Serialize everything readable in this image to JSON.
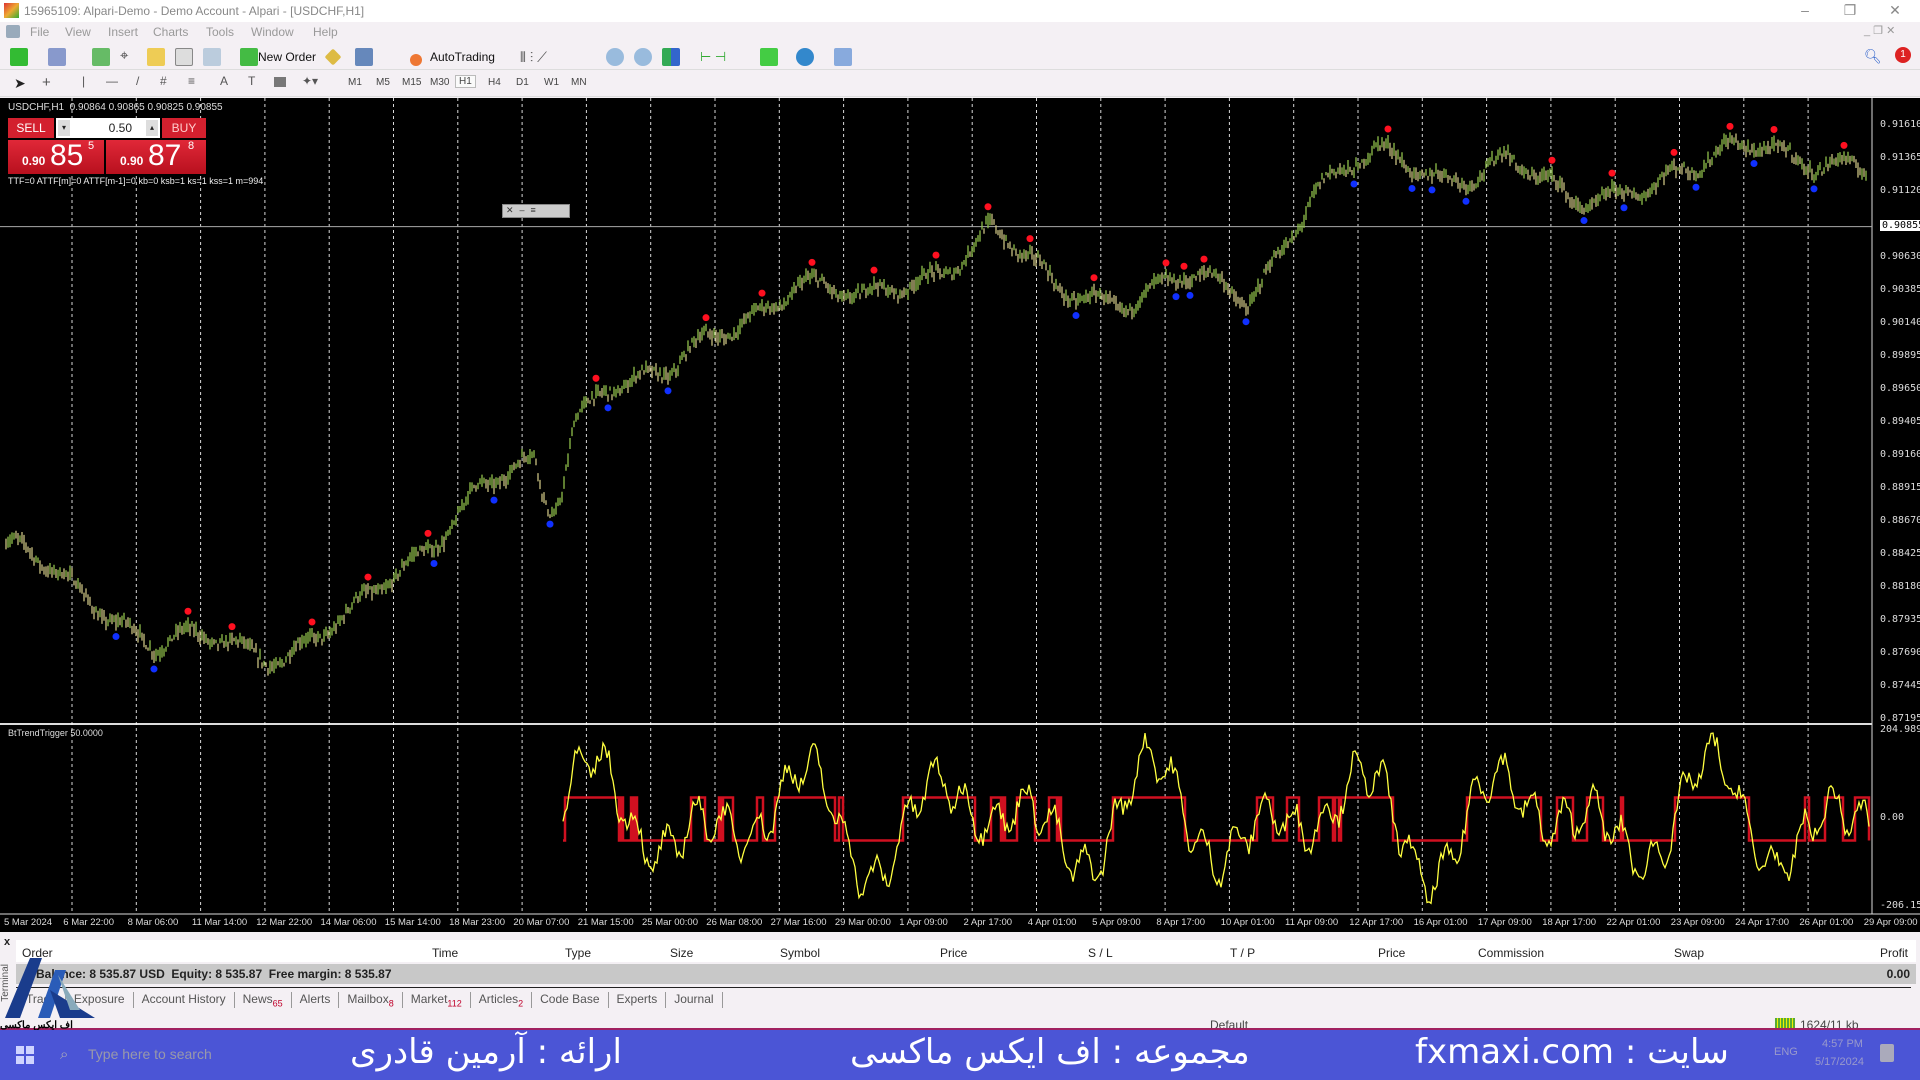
{
  "window": {
    "title": "15965109: Alpari-Demo - Demo Account - Alpari - [USDCHF,H1]"
  },
  "menu": [
    "File",
    "View",
    "Insert",
    "Charts",
    "Tools",
    "Window",
    "Help"
  ],
  "toolbar": {
    "new_order": "New Order",
    "autotrading": "AutoTrading",
    "notification_count": "1"
  },
  "timeframes": [
    "M1",
    "M5",
    "M15",
    "M30",
    "H1",
    "H4",
    "D1",
    "W1",
    "MN"
  ],
  "active_timeframe": "H1",
  "chart": {
    "header": "USDCHF,H1  0.90864 0.90865 0.90825 0.90855",
    "sell_label": "SELL",
    "buy_label": "BUY",
    "lot": "0.50",
    "sell_prefix": "0.90",
    "sell_big": "85",
    "sell_sup": "5",
    "buy_prefix": "0.90",
    "buy_big": "87",
    "buy_sup": "8",
    "status_line": "TTF=0 ATTF[m]=0 ATTF[m-1]=0 kb=0 ksb=1 ks=1 kss=1 m=994",
    "current_price": "0.90855",
    "price_labels": [
      "0.91610",
      "0.91365",
      "0.91120",
      "0.90855",
      "0.90630",
      "0.90385",
      "0.90140",
      "0.89895",
      "0.89650",
      "0.89405",
      "0.89160",
      "0.88915",
      "0.88670",
      "0.88425",
      "0.88180",
      "0.87935",
      "0.87690",
      "0.87445",
      "0.87195"
    ],
    "price_range": [
      0.87195,
      0.9161
    ],
    "time_labels": [
      "5 Mar 2024",
      "6 Mar 22:00",
      "8 Mar 06:00",
      "11 Mar 14:00",
      "12 Mar 22:00",
      "14 Mar 06:00",
      "15 Mar 14:00",
      "18 Mar 23:00",
      "20 Mar 07:00",
      "21 Mar 15:00",
      "25 Mar 00:00",
      "26 Mar 08:00",
      "27 Mar 16:00",
      "29 Mar 00:00",
      "1 Apr 09:00",
      "2 Apr 17:00",
      "4 Apr 01:00",
      "5 Apr 09:00",
      "8 Apr 17:00",
      "10 Apr 01:00",
      "11 Apr 09:00",
      "12 Apr 17:00",
      "16 Apr 01:00",
      "17 Apr 09:00",
      "18 Apr 17:00",
      "22 Apr 01:00",
      "23 Apr 09:00",
      "24 Apr 17:00",
      "26 Apr 01:00",
      "29 Apr 09:00"
    ],
    "approx_price_at_time_labels": [
      0.884,
      0.8815,
      0.877,
      0.8778,
      0.877,
      0.879,
      0.884,
      0.8892,
      0.8905,
      0.8975,
      0.8975,
      0.901,
      0.905,
      0.9025,
      0.905,
      0.9085,
      0.9035,
      0.9035,
      0.9045,
      0.903,
      0.9115,
      0.9135,
      0.9125,
      0.9135,
      0.91,
      0.912,
      0.9125,
      0.915,
      0.9135,
      0.9115
    ],
    "colors": {
      "bull": "#8fbf4a",
      "bear": "#c8c080",
      "high_dot": "#ff1020",
      "low_dot": "#1030ff",
      "grid": "#ffffff"
    },
    "indicator": {
      "name": "BtTrendTrigger 50.0000",
      "max": "204.9896",
      "zero": "0.00",
      "min": "-206.1509",
      "levels": [
        50,
        -50
      ],
      "line_color": "#ffff40",
      "trigger_color": "#d01020"
    }
  },
  "terminal": {
    "columns": [
      "Order",
      "Time",
      "Type",
      "Size",
      "Symbol",
      "Price",
      "S / L",
      "T / P",
      "Price",
      "Commission",
      "Swap",
      "Profit"
    ],
    "balance_line": "Balance: 8 535.87 USD  Equity: 8 535.87  Free margin: 8 535.87",
    "profit": "0.00",
    "tabs": [
      {
        "label": "Trade"
      },
      {
        "label": "Exposure"
      },
      {
        "label": "Account History"
      },
      {
        "label": "News",
        "badge": "65"
      },
      {
        "label": "Alerts"
      },
      {
        "label": "Mailbox",
        "badge": "8"
      },
      {
        "label": "Market",
        "badge": "112"
      },
      {
        "label": "Articles",
        "badge": "2"
      },
      {
        "label": "Code Base"
      },
      {
        "label": "Experts"
      },
      {
        "label": "Journal"
      }
    ],
    "side_label": "Terminal",
    "status_profile": "Default",
    "status_traffic": "1624/11 kb"
  },
  "taskbar": {
    "search_placeholder": "Type here to search",
    "time": "4:57 PM",
    "date": "5/17/2024",
    "lang": "ENG"
  },
  "overlay": {
    "presenter": "ارائه : آرمین قادری",
    "group": "مجموعه : اف ایکس ماکسی",
    "site": "fxmaxi.com : سایت",
    "logo_text": "اف ایکس ماکسی"
  }
}
